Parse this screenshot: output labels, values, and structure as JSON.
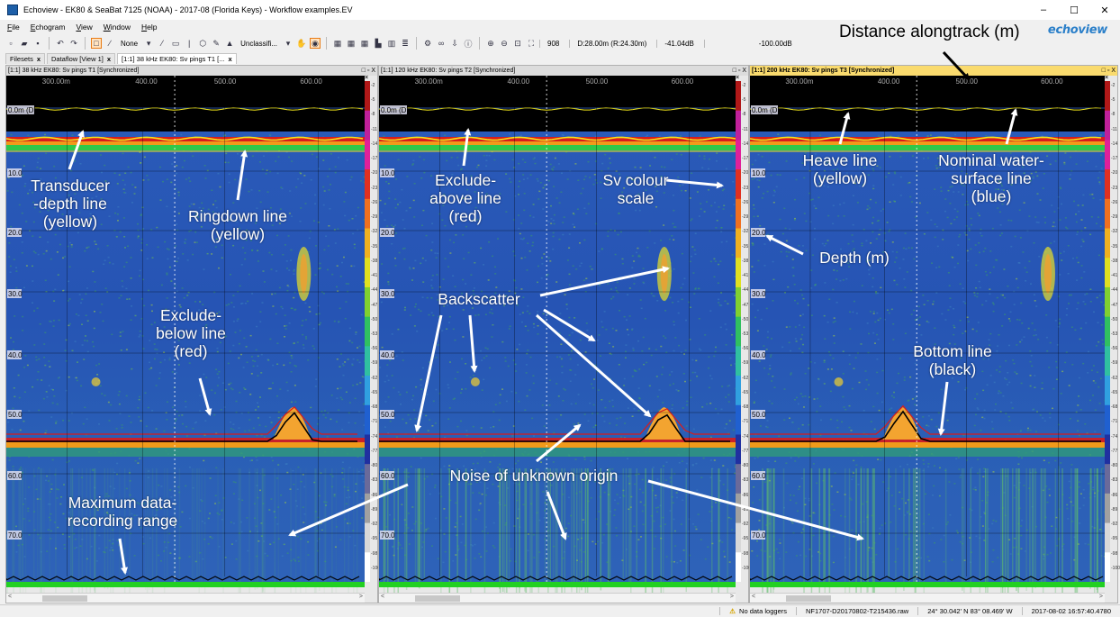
{
  "window": {
    "title": "Echoview - EK80 & SeaBat 7125 (NOAA) - 2017-08 (Florida Keys) - Workflow examples.EV",
    "controls": {
      "minimize": "–",
      "maximize": "☐",
      "close": "✕"
    }
  },
  "menu": [
    "File",
    "Echogram",
    "View",
    "Window",
    "Help"
  ],
  "toolbar": {
    "line_select": "None",
    "region_class": "Unclassifi...",
    "ping_number": "908",
    "depth_readout": "D:28.00m (R:24.30m)",
    "sv_readout": "-41.04dB",
    "threshold_readout": "-100.00dB"
  },
  "brand": "echoview",
  "tabs": [
    {
      "label": "Filesets",
      "close": "x"
    },
    {
      "label": "Dataflow [View 1]",
      "close": "x"
    },
    {
      "label": "[1:1] 38 kHz EK80: Sv pings T1 [...",
      "close": "x"
    }
  ],
  "panes": [
    {
      "title": "[1:1] 38 kHz EK80: Sv pings T1 [Synchronized]",
      "active": false,
      "buttons": "□ ▫ X"
    },
    {
      "title": "[1:1] 120 kHz EK80: Sv pings T2 [Synchronized]",
      "active": false,
      "buttons": "□ ▫ X"
    },
    {
      "title": "[1:1] 200 kHz EK80: Sv pings T3 [Synchronized]",
      "active": true,
      "buttons": "□ ▫ X"
    }
  ],
  "distance_ticks": [
    "300.00m",
    "400.00",
    "500.00",
    "600.00"
  ],
  "depth_labels": [
    "0.0m (D)",
    "10.0",
    "20.0",
    "30.0",
    "40.0",
    "50.0",
    "60.0",
    "70.0"
  ],
  "scale_x": "×",
  "scale_ticks": [
    "-2",
    "-5",
    "-8",
    "-11",
    "-14",
    "-17",
    "-20",
    "-23",
    "-26",
    "-29",
    "-32",
    "-35",
    "-38",
    "-41",
    "-44",
    "-47",
    "-50",
    "-53",
    "-56",
    "-59",
    "-62",
    "-65",
    "-68",
    "-71",
    "-74",
    "-77",
    "-80",
    "-83",
    "-86",
    "-89",
    "-92",
    "-95",
    "-98",
    "-100"
  ],
  "scroll": {
    "left": "<",
    "right": ">"
  },
  "status": {
    "warning_icon": "⚠",
    "loggers": "No data loggers",
    "file": "NF1707-D20170802-T215436.raw",
    "position": "24° 30.042' N 83° 08.469' W",
    "datetime": "2017-08-02 16:57:40.4780"
  },
  "annotations": {
    "distance": "Distance alongtrack (m)",
    "transducer": "Transducer\n-depth line\n(yellow)",
    "ringdown": "Ringdown line\n(yellow)",
    "exclude_below": "Exclude-\nbelow line\n(red)",
    "max_range": "Maximum data-\nrecording range",
    "exclude_above": "Exclude-\nabove line\n(red)",
    "sv_colour": "Sv colour\nscale",
    "backscatter": "Backscatter",
    "noise": "Noise of unknown origin",
    "heave": "Heave line\n(yellow)",
    "nominal": "Nominal water-\nsurface line\n(blue)",
    "depth": "Depth (m)",
    "bottom": "Bottom line\n(black)"
  },
  "colors": {
    "water_blue": "#2a52b4",
    "water_green": "#3aa05a",
    "noise_green": "#5fbf6a",
    "seabed_red": "#e23a1e",
    "seabed_orange": "#f19a1a",
    "near_field_green": "#2fc84a",
    "exclude_red": "#d81c1c",
    "line_yellow": "#f3e81b",
    "surface_blue": "#3a6fd8",
    "bottom_black": "#000000",
    "active_title": "#fadb6e",
    "brand_blue": "#2a7fc9"
  },
  "palette": [
    "#ffffff",
    "#d8d8d8",
    "#a0a0a0",
    "#6a6a9a",
    "#2030a0",
    "#2060d0",
    "#30a0e0",
    "#30c0a0",
    "#30c060",
    "#80d030",
    "#e0e020",
    "#f0b020",
    "#f07020",
    "#e03020",
    "#e0209a",
    "#c0209a",
    "#b01818"
  ]
}
